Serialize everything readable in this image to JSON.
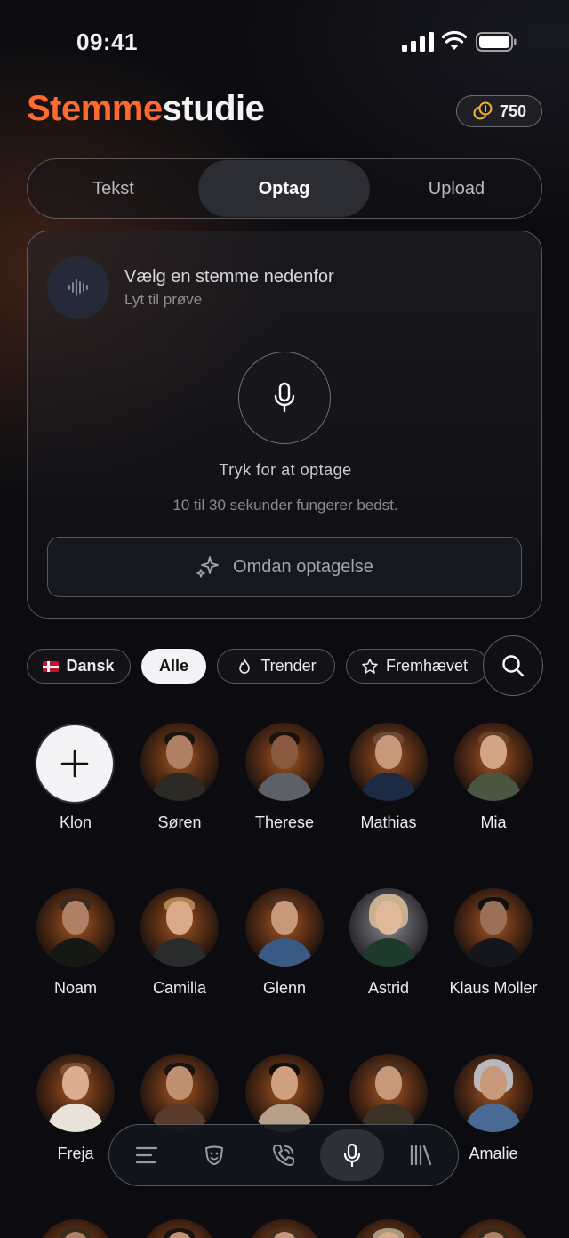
{
  "status_bar": {
    "time": "09:41"
  },
  "header": {
    "title_part1": "Stemme",
    "title_part2": "studie",
    "credits": "750"
  },
  "tabs": [
    {
      "label": "Tekst"
    },
    {
      "label": "Optag",
      "active": true
    },
    {
      "label": "Upload"
    }
  ],
  "record_card": {
    "voice_title": "Vælg en stemme nedenfor",
    "voice_subtitle": "Lyt til prøve",
    "tap_label": "Tryk for at optage",
    "hint": "10 til 30 sekunder fungerer bedst.",
    "convert_label": "Omdan optagelse"
  },
  "filters": [
    {
      "label": "Dansk"
    },
    {
      "label": "Alle",
      "active": true
    },
    {
      "label": "Trender"
    },
    {
      "label": "Fremhævet"
    }
  ],
  "voices": [
    {
      "name": "Klon"
    },
    {
      "name": "Søren"
    },
    {
      "name": "Therese"
    },
    {
      "name": "Mathias"
    },
    {
      "name": "Mia"
    },
    {
      "name": "Noam"
    },
    {
      "name": "Camilla"
    },
    {
      "name": "Glenn"
    },
    {
      "name": "Astrid"
    },
    {
      "name": "Klaus Moller"
    },
    {
      "name": "Freja"
    },
    {
      "name": "Amalie"
    }
  ],
  "colors": {
    "accent": "#ff6a2e",
    "background": "#0c0c10"
  },
  "bottom_nav": [
    "menu-icon",
    "masks-icon",
    "phone-icon",
    "microphone-icon",
    "library-icon"
  ]
}
